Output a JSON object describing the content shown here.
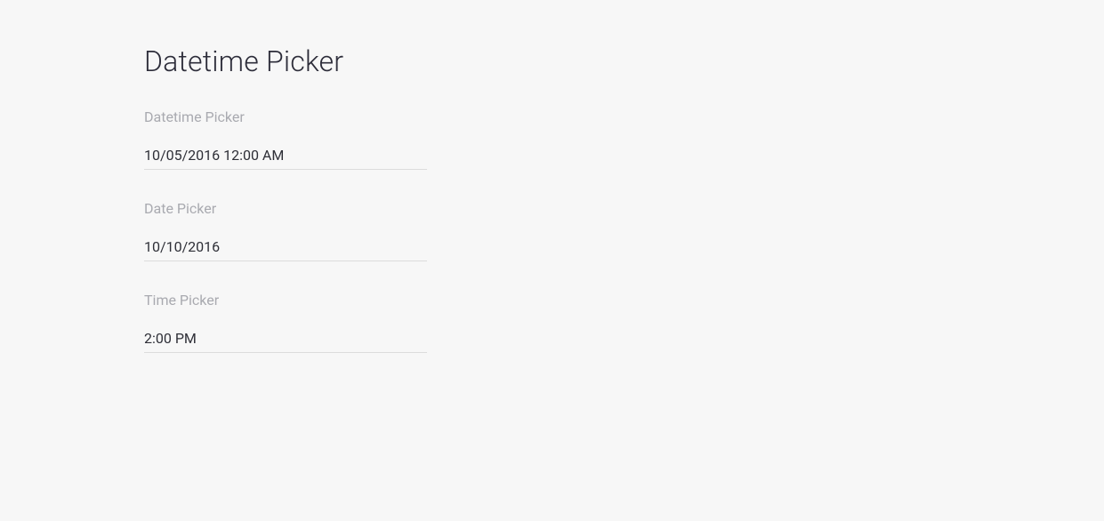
{
  "page": {
    "title": "Datetime Picker"
  },
  "fields": {
    "datetime": {
      "label": "Datetime Picker",
      "value": "10/05/2016 12:00 AM"
    },
    "date": {
      "label": "Date Picker",
      "value": "10/10/2016"
    },
    "time": {
      "label": "Time Picker",
      "value": "2:00 PM"
    }
  }
}
